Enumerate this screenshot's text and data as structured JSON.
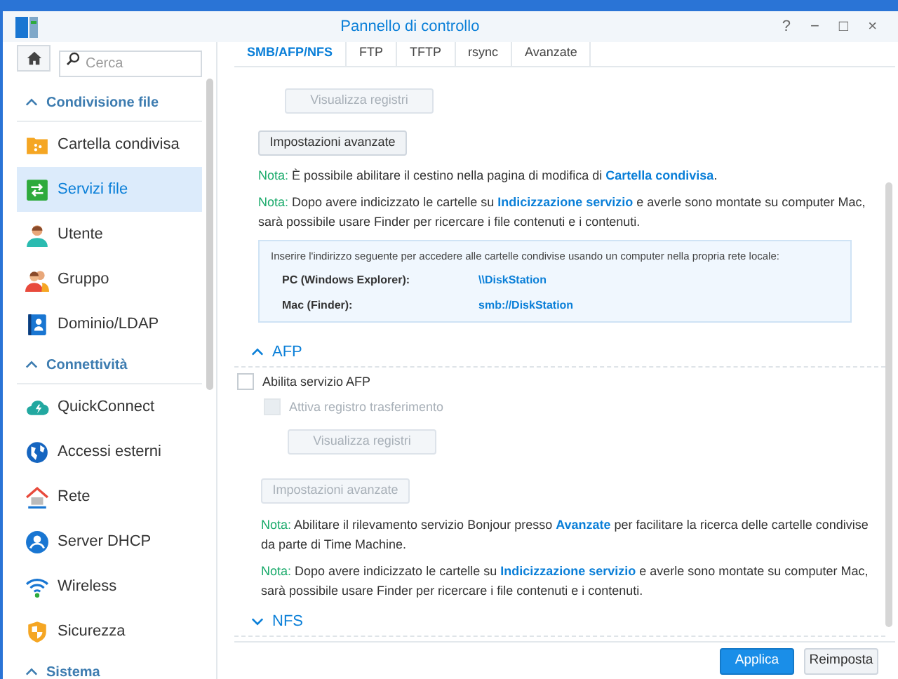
{
  "window": {
    "title": "Pannello di controllo",
    "controls": [
      "?",
      "−",
      "□",
      "×"
    ]
  },
  "sidebar": {
    "search": {
      "placeholder": "Cerca"
    },
    "sections": [
      {
        "title": "Condivisione file",
        "expanded": true,
        "items": [
          {
            "label": "Cartella condivisa",
            "selected": false
          },
          {
            "label": "Servizi file",
            "selected": true
          },
          {
            "label": "Utente",
            "selected": false
          },
          {
            "label": "Gruppo",
            "selected": false
          },
          {
            "label": "Dominio/LDAP",
            "selected": false
          }
        ]
      },
      {
        "title": "Connettività",
        "expanded": true,
        "items": [
          {
            "label": "QuickConnect",
            "selected": false
          },
          {
            "label": "Accessi esterni",
            "selected": false
          },
          {
            "label": "Rete",
            "selected": false
          },
          {
            "label": "Server DHCP",
            "selected": false
          },
          {
            "label": "Wireless",
            "selected": false
          },
          {
            "label": "Sicurezza",
            "selected": false
          }
        ]
      },
      {
        "title": "Sistema",
        "expanded": true
      }
    ]
  },
  "tabs": [
    {
      "label": "SMB/AFP/NFS",
      "selected": true
    },
    {
      "label": "FTP",
      "selected": false
    },
    {
      "label": "TFTP",
      "selected": false
    },
    {
      "label": "rsync",
      "selected": false
    },
    {
      "label": "Avanzate",
      "selected": false
    }
  ],
  "smb": {
    "buttons": [
      {
        "label": "Visualizza registri",
        "disabled": true
      },
      {
        "label": "Impostazioni avanzate",
        "disabled": false
      }
    ],
    "notes": [
      {
        "label": "Nota:",
        "parts": [
          {
            "text": " È possibile abilitare il cestino nella pagina di modifica di "
          },
          {
            "link": "Cartella condivisa"
          },
          {
            "text": "."
          }
        ]
      },
      {
        "label": "Nota:",
        "parts": [
          {
            "text": " Dopo avere indicizzato le cartelle su "
          },
          {
            "link": "Indicizzazione servizio"
          },
          {
            "text": " e averle sono montate su computer Mac, sarà possibile usare Finder per ricercare i file contenuti e i contenuti."
          }
        ]
      }
    ],
    "info": {
      "intro": "Inserire l'indirizzo seguente per accedere alle cartelle condivise usando un computer nella propria rete locale:",
      "rows": [
        {
          "label": "PC (Windows Explorer):",
          "value": "\\\\DiskStation"
        },
        {
          "label": "Mac (Finder):",
          "value": "smb://DiskStation"
        }
      ]
    }
  },
  "afp": {
    "title": "AFP",
    "expanded": true,
    "checkboxes": [
      {
        "label": "Abilita servizio AFP",
        "checked": false,
        "disabled": false
      },
      {
        "label": "Attiva registro trasferimento",
        "checked": false,
        "disabled": true
      }
    ],
    "buttons": [
      {
        "label": "Visualizza registri",
        "disabled": true
      },
      {
        "label": "Impostazioni avanzate",
        "disabled": true
      }
    ],
    "notes": [
      {
        "label": "Nota:",
        "parts": [
          {
            "text": " Abilitare il rilevamento servizio Bonjour presso "
          },
          {
            "link": "Avanzate"
          },
          {
            "text": " per facilitare la ricerca delle cartelle condivise da parte di Time Machine."
          }
        ]
      },
      {
        "label": "Nota:",
        "parts": [
          {
            "text": " Dopo avere indicizzato le cartelle su "
          },
          {
            "link": "Indicizzazione servizio"
          },
          {
            "text": " e averle sono montate su computer Mac, sarà possibile usare Finder per ricercare i file contenuti e i contenuti."
          }
        ]
      }
    ]
  },
  "nfs": {
    "title": "NFS",
    "expanded": false
  },
  "footer": {
    "buttons": [
      {
        "label": "Applica",
        "kind": "primary"
      },
      {
        "label": "Reimposta",
        "kind": "secondary"
      }
    ]
  }
}
